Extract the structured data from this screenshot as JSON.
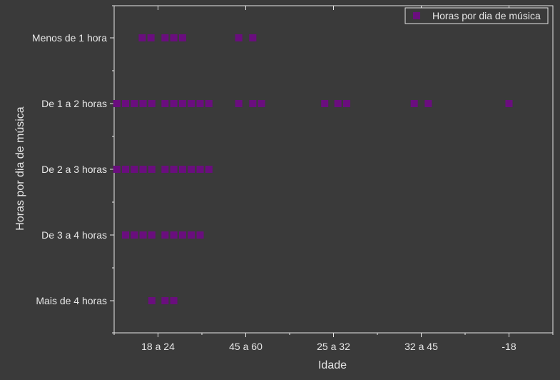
{
  "colors": {
    "background": "#3a3a3a",
    "axis": "#e6e6e6",
    "text": "#e6e6e6",
    "marker": "#6a0e7e",
    "legend_background": "#3a3a3a",
    "legend_border": "#e6e6e6"
  },
  "chart_data": {
    "type": "scatter",
    "title": "",
    "xlabel": "Idade",
    "ylabel": "Horas por dia de música",
    "x_ticks": [
      "18 a 24",
      "45 a 60",
      "25 a 32",
      "32 a 45",
      "-18"
    ],
    "y_categories": [
      "Mais de 4 horas",
      "De 3 a 4 horas",
      "De 2 a 3 horas",
      "De 1 a 2 horas",
      "Menos de 1 hora"
    ],
    "xlim": [
      0.5,
      5.5
    ],
    "grid": false,
    "legend_position": "top-right",
    "series": [
      {
        "name": "Horas por dia de música",
        "marker": "square",
        "points": [
          {
            "x": 0.82,
            "y": "Menos de 1 hora"
          },
          {
            "x": 0.92,
            "y": "Menos de 1 hora"
          },
          {
            "x": 1.08,
            "y": "Menos de 1 hora"
          },
          {
            "x": 1.18,
            "y": "Menos de 1 hora"
          },
          {
            "x": 1.28,
            "y": "Menos de 1 hora"
          },
          {
            "x": 1.92,
            "y": "Menos de 1 hora"
          },
          {
            "x": 2.08,
            "y": "Menos de 1 hora"
          },
          {
            "x": 0.53,
            "y": "De 1 a 2 horas"
          },
          {
            "x": 0.63,
            "y": "De 1 a 2 horas"
          },
          {
            "x": 0.73,
            "y": "De 1 a 2 horas"
          },
          {
            "x": 0.83,
            "y": "De 1 a 2 horas"
          },
          {
            "x": 0.93,
            "y": "De 1 a 2 horas"
          },
          {
            "x": 1.08,
            "y": "De 1 a 2 horas"
          },
          {
            "x": 1.18,
            "y": "De 1 a 2 horas"
          },
          {
            "x": 1.28,
            "y": "De 1 a 2 horas"
          },
          {
            "x": 1.38,
            "y": "De 1 a 2 horas"
          },
          {
            "x": 1.48,
            "y": "De 1 a 2 horas"
          },
          {
            "x": 1.58,
            "y": "De 1 a 2 horas"
          },
          {
            "x": 1.92,
            "y": "De 1 a 2 horas"
          },
          {
            "x": 2.08,
            "y": "De 1 a 2 horas"
          },
          {
            "x": 2.18,
            "y": "De 1 a 2 horas"
          },
          {
            "x": 2.9,
            "y": "De 1 a 2 horas"
          },
          {
            "x": 3.05,
            "y": "De 1 a 2 horas"
          },
          {
            "x": 3.15,
            "y": "De 1 a 2 horas"
          },
          {
            "x": 3.92,
            "y": "De 1 a 2 horas"
          },
          {
            "x": 4.08,
            "y": "De 1 a 2 horas"
          },
          {
            "x": 5.0,
            "y": "De 1 a 2 horas"
          },
          {
            "x": 0.53,
            "y": "De 2 a 3 horas"
          },
          {
            "x": 0.63,
            "y": "De 2 a 3 horas"
          },
          {
            "x": 0.73,
            "y": "De 2 a 3 horas"
          },
          {
            "x": 0.83,
            "y": "De 2 a 3 horas"
          },
          {
            "x": 0.93,
            "y": "De 2 a 3 horas"
          },
          {
            "x": 1.08,
            "y": "De 2 a 3 horas"
          },
          {
            "x": 1.18,
            "y": "De 2 a 3 horas"
          },
          {
            "x": 1.28,
            "y": "De 2 a 3 horas"
          },
          {
            "x": 1.38,
            "y": "De 2 a 3 horas"
          },
          {
            "x": 1.48,
            "y": "De 2 a 3 horas"
          },
          {
            "x": 1.58,
            "y": "De 2 a 3 horas"
          },
          {
            "x": 0.63,
            "y": "De 3 a 4 horas"
          },
          {
            "x": 0.73,
            "y": "De 3 a 4 horas"
          },
          {
            "x": 0.83,
            "y": "De 3 a 4 horas"
          },
          {
            "x": 0.93,
            "y": "De 3 a 4 horas"
          },
          {
            "x": 1.08,
            "y": "De 3 a 4 horas"
          },
          {
            "x": 1.18,
            "y": "De 3 a 4 horas"
          },
          {
            "x": 1.28,
            "y": "De 3 a 4 horas"
          },
          {
            "x": 1.38,
            "y": "De 3 a 4 horas"
          },
          {
            "x": 1.48,
            "y": "De 3 a 4 horas"
          },
          {
            "x": 0.93,
            "y": "Mais de 4 horas"
          },
          {
            "x": 1.08,
            "y": "Mais de 4 horas"
          },
          {
            "x": 1.18,
            "y": "Mais de 4 horas"
          }
        ]
      }
    ]
  }
}
